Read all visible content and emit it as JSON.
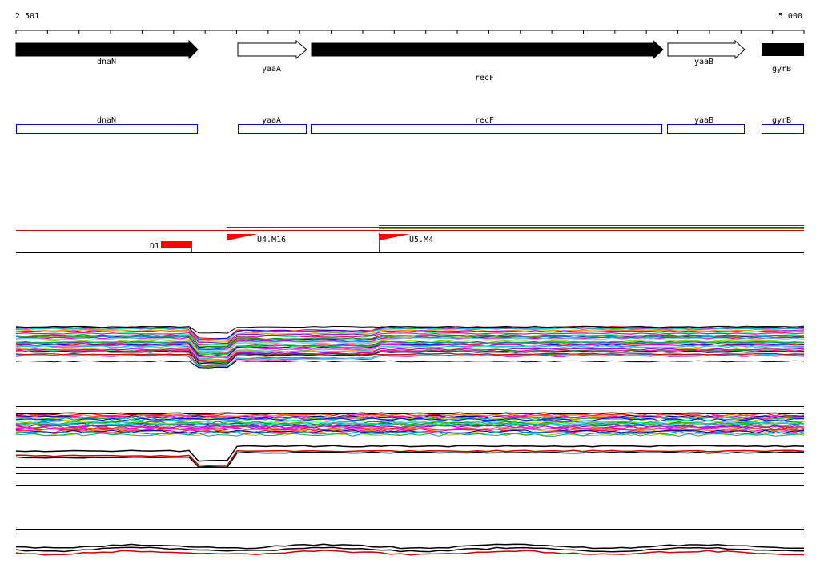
{
  "ruler": {
    "start_label": "2 501",
    "end_label": "5 000"
  },
  "genes": [
    {
      "name": "dnaN",
      "strand": "+",
      "filled": true
    },
    {
      "name": "yaaA",
      "strand": "+",
      "filled": false
    },
    {
      "name": "recF",
      "strand": "+",
      "filled": true
    },
    {
      "name": "yaaB",
      "strand": "+",
      "filled": false
    },
    {
      "name": "gyrB",
      "strand": "+",
      "filled": true
    }
  ],
  "annotation_boxes": [
    "dnaN",
    "yaaA",
    "recF",
    "yaaB",
    "gyrB"
  ],
  "features": [
    {
      "label": "D1",
      "type": "block"
    },
    {
      "label": "U4.M16",
      "type": "flag"
    },
    {
      "label": "U5.M4",
      "type": "flag"
    }
  ],
  "colors": {
    "gene_fill": "#000000",
    "annotation_box": "#0000cc",
    "feature_red": "#ff0000",
    "feature_line_red": "#cc0000",
    "feature_line_green": "#669933"
  }
}
